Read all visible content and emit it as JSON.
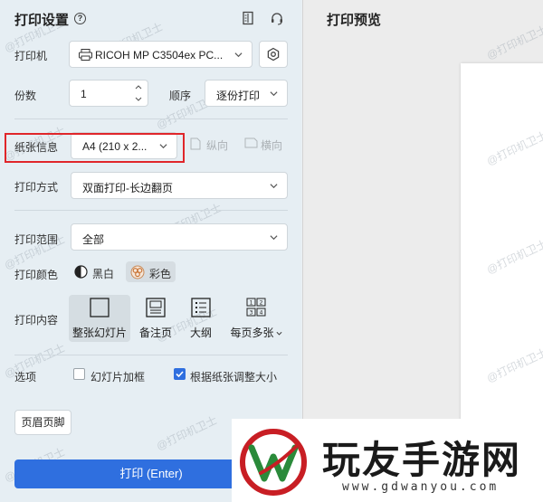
{
  "settings": {
    "title": "打印设置",
    "printer": {
      "label": "打印机",
      "value": "RICOH MP C3504ex PC..."
    },
    "copies": {
      "label": "份数",
      "value": "1"
    },
    "order": {
      "label": "顺序",
      "value": "逐份打印"
    },
    "paper": {
      "label": "纸张信息",
      "value": "A4 (210 x 2...",
      "portrait": "纵向",
      "landscape": "横向"
    },
    "mode": {
      "label": "打印方式",
      "value": "双面打印-长边翻页"
    },
    "range": {
      "label": "打印范围",
      "value": "全部"
    },
    "color": {
      "label": "打印颜色",
      "bw": "黑白",
      "color": "彩色"
    },
    "content": {
      "label": "打印内容",
      "items": [
        {
          "label": "整张幻灯片",
          "selected": true
        },
        {
          "label": "备注页"
        },
        {
          "label": "大纲"
        },
        {
          "label": "每页多张",
          "icon_text": "1 2 3 4"
        }
      ]
    },
    "options": {
      "label": "选项",
      "frame": "幻灯片加框",
      "fit": "根据纸张调整大小"
    },
    "header_footer": "页眉页脚",
    "print_button": "打印 (Enter)"
  },
  "preview": {
    "title": "打印预览"
  },
  "watermark": "@打印机卫士",
  "logo": {
    "text": "玩友手游网",
    "url": "www.gdwanyou.com"
  },
  "colors": {
    "accent": "#2f6fdf",
    "highlight": "#e0262a"
  }
}
